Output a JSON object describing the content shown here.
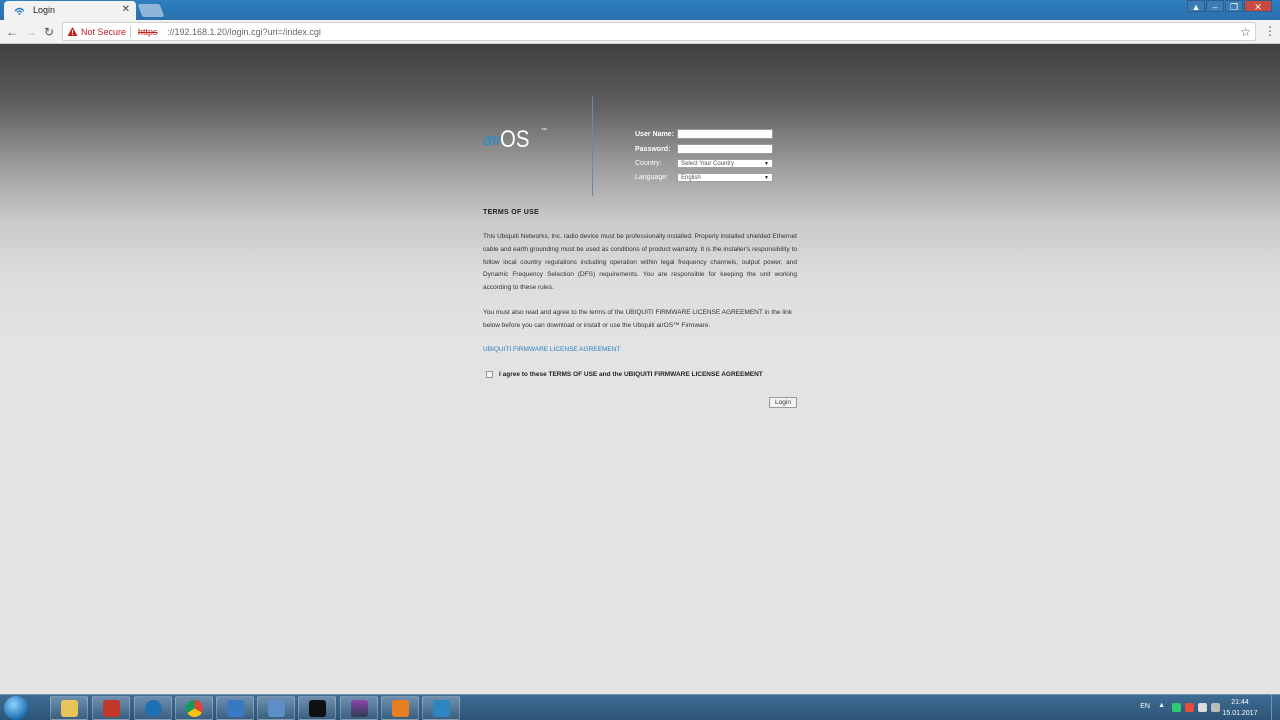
{
  "browser": {
    "tab_title": "Login",
    "security_label": "Not Secure",
    "url_scheme": "https",
    "url_rest": "://192.168.1.20/login.cgi?uri=/index.cgi"
  },
  "login": {
    "logo_prefix": "air",
    "logo_main": "OS",
    "logo_tm": "™",
    "username_label": "User Name:",
    "password_label": "Password:",
    "country_label": "Country:",
    "country_value": "Select Your Country",
    "language_label": "Language:",
    "language_value": "English",
    "terms_heading": "TERMS OF USE",
    "terms_paragraph1": "This Ubiquiti Networks, Inc. radio device must be professionally installed. Properly installed shielded Ethernet cable and earth grounding must be used as conditions of product warranty. It is the installer's responsibility to follow local country regulations including operation within legal frequency channels, output power, and Dynamic Frequency Selection (DFS) requirements. You are responsible for keeping the unit working according to these rules.",
    "terms_paragraph2": "You must also read and agree to the terms of the UBIQUITI FIRMWARE LICENSE AGREEMENT in the link below before you can download or install or use the Ubiquiti airOS™ Firmware.",
    "license_link": "UBIQUITI FIRMWARE LICENSE AGREEMENT",
    "agree_text": "I agree to these TERMS OF USE and the UBIQUITI FIRMWARE LICENSE AGREEMENT",
    "login_button": "Login"
  },
  "taskbar": {
    "language": "EN",
    "time": "21:44",
    "date": "15.01.2017"
  },
  "colors": {
    "accent": "#2f7fc0",
    "logo_blue": "#1f8fd0"
  }
}
